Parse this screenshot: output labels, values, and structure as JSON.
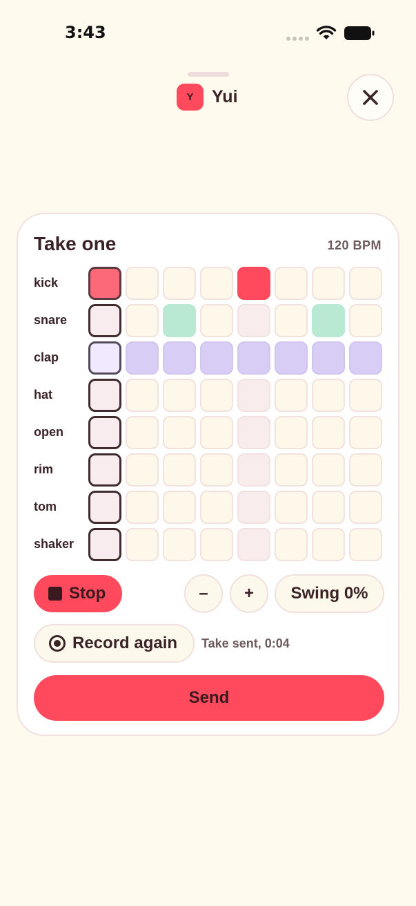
{
  "status_bar": {
    "time": "3:43"
  },
  "header": {
    "avatar_initial": "Y",
    "contact_name": "Yui"
  },
  "card": {
    "title": "Take one",
    "bpm": "120 BPM",
    "tracks": [
      {
        "label": "kick",
        "steps": [
          1,
          0,
          0,
          0,
          1,
          0,
          0,
          0
        ]
      },
      {
        "label": "snare",
        "steps": [
          0,
          0,
          1,
          0,
          0,
          0,
          1,
          0
        ]
      },
      {
        "label": "clap",
        "steps": [
          1,
          1,
          1,
          1,
          1,
          1,
          1,
          1
        ]
      },
      {
        "label": "hat",
        "steps": [
          0,
          0,
          0,
          0,
          0,
          0,
          0,
          0
        ]
      },
      {
        "label": "open",
        "steps": [
          0,
          0,
          0,
          0,
          0,
          0,
          0,
          0
        ]
      },
      {
        "label": "rim",
        "steps": [
          0,
          0,
          0,
          0,
          0,
          0,
          0,
          0
        ]
      },
      {
        "label": "tom",
        "steps": [
          0,
          0,
          0,
          0,
          0,
          0,
          0,
          0
        ]
      },
      {
        "label": "shaker",
        "steps": [
          0,
          0,
          0,
          0,
          0,
          0,
          0,
          0
        ]
      }
    ],
    "playhead_step": 1
  },
  "controls": {
    "stop_label": "Stop",
    "minus_label": "–",
    "plus_label": "+",
    "swing_label": "Swing 0%",
    "record_label": "Record again",
    "take_status": "Take sent, 0:04",
    "send_label": "Send"
  },
  "colors": {
    "accent": "#ff4a5e",
    "background": "#fff9ee",
    "snare_on": "#b9e8d3",
    "clap_on": "#d8cdf5"
  },
  "icons": {
    "close": "close-icon",
    "stop": "stop-icon",
    "record": "record-icon",
    "wifi": "wifi-icon",
    "battery": "battery-icon"
  }
}
